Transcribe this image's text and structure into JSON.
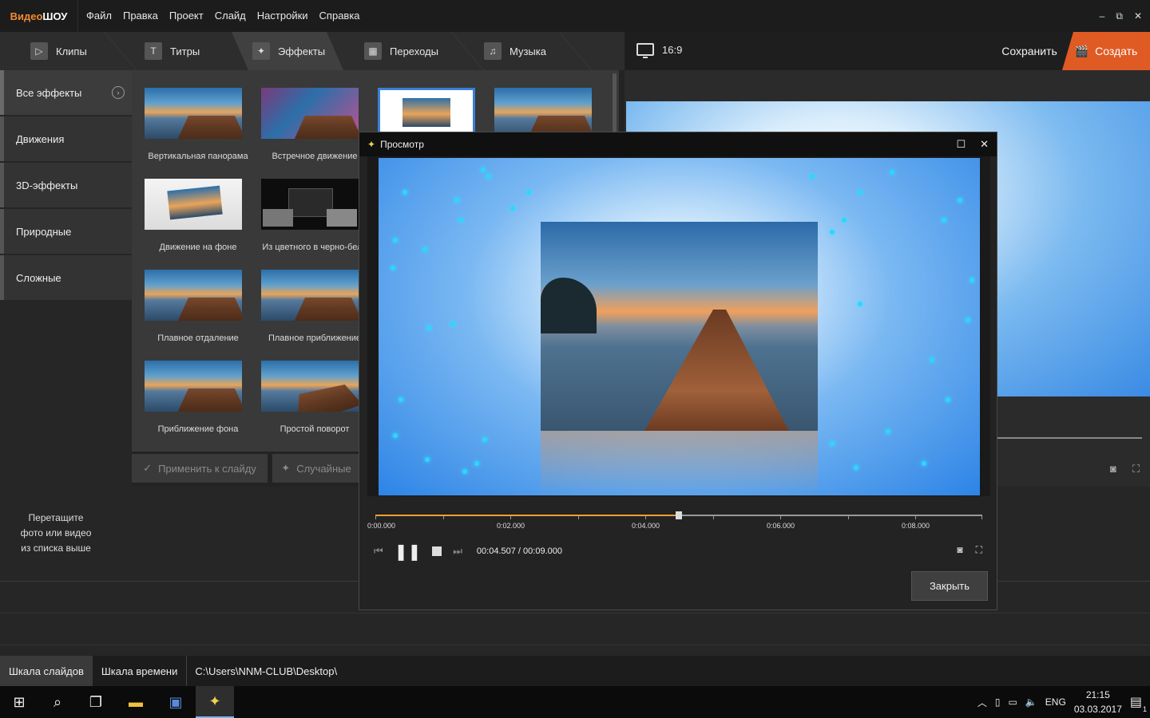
{
  "app": {
    "logo_part1": "Видео",
    "logo_part2": "ШОУ",
    "menu": [
      "Файл",
      "Правка",
      "Проект",
      "Слайд",
      "Настройки",
      "Справка"
    ],
    "window_controls": {
      "minimize": "–",
      "restore": "⧉",
      "close": "✕"
    }
  },
  "tabs": [
    {
      "label": "Клипы",
      "icon": "play-icon"
    },
    {
      "label": "Титры",
      "icon": "text-icon"
    },
    {
      "label": "Эффекты",
      "icon": "magic-wand-icon"
    },
    {
      "label": "Переходы",
      "icon": "clapper-icon"
    },
    {
      "label": "Музыка",
      "icon": "music-note-icon"
    }
  ],
  "active_tab": "Эффекты",
  "header": {
    "aspect_ratio": "16:9",
    "save_label": "Сохранить",
    "create_label": "Создать",
    "create_color": "#e05a24"
  },
  "categories": [
    "Все эффекты",
    "Движения",
    "3D-эффекты",
    "Природные",
    "Сложные"
  ],
  "effects": [
    "Вертикальная панорама",
    "Встречное движение",
    "",
    "",
    "Движение на фоне",
    "Из цветного в черно-бело",
    "Плавное отдаление",
    "Плавное приближение",
    "Приближение фона",
    "Простой поворот"
  ],
  "actions": {
    "apply_label": "Применить к слайду",
    "random_label": "Случайные"
  },
  "drag_hint": [
    "Перетащите",
    "фото или видео",
    "из списка выше"
  ],
  "bottom_tabs": [
    "Шкала слайдов",
    "Шкала времени"
  ],
  "path": "C:\\Users\\NNM-CLUB\\Desktop\\",
  "modal": {
    "title": "Просмотр",
    "time_current": "00:04.507",
    "time_separator": "/",
    "time_total": "00:09.000",
    "tick_labels": [
      "0:00.000",
      "0:02.000",
      "0:04.000",
      "0:06.000",
      "0:08.000"
    ],
    "progress_fraction": 0.5,
    "close_label": "Закрыть"
  },
  "taskbar": {
    "lang": "ENG",
    "time": "21:15",
    "date": "03.03.2017",
    "notification_count": "1"
  }
}
